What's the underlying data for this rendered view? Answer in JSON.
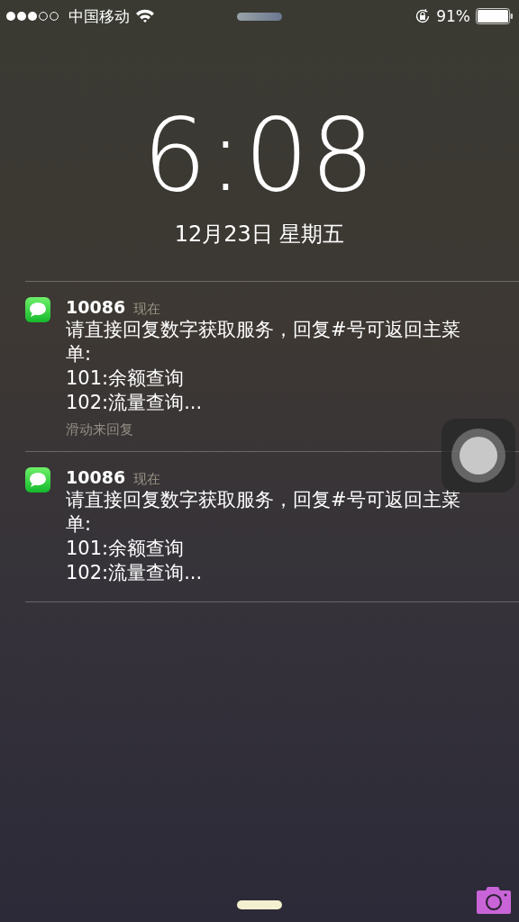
{
  "status_bar": {
    "carrier": "中国移动",
    "battery_percent": "91%"
  },
  "lock_screen": {
    "time": "6:08",
    "date": "12月23日 星期五"
  },
  "notifications": [
    {
      "sender": "10086",
      "time": "现在",
      "lines": [
        "请直接回复数字获取服务，回复#号可返回主菜单:",
        "101:余额查询",
        "102:流量查询..."
      ],
      "hint": "滑动来回复"
    },
    {
      "sender": "10086",
      "time": "现在",
      "lines": [
        "请直接回复数字获取服务，回复#号可返回主菜单:",
        "101:余额查询",
        "102:流量查询..."
      ]
    }
  ]
}
